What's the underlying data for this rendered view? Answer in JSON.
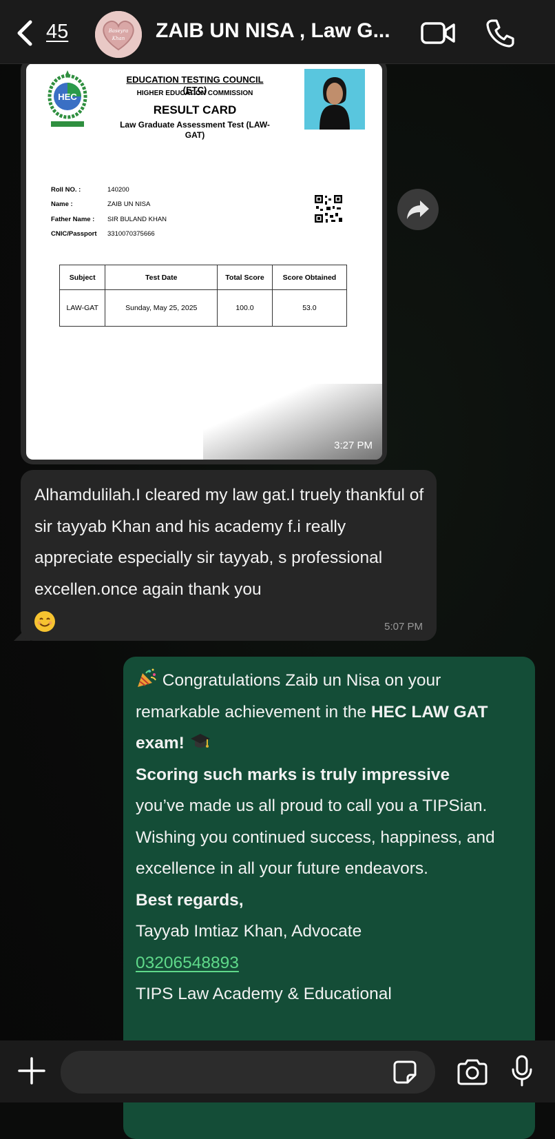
{
  "header": {
    "back_count": "45",
    "title": "ZAIB UN  NISA , Law G...",
    "avatar_text_line1": "Baseyra",
    "avatar_text_line2": "Khan"
  },
  "card": {
    "org": "EDUCATION TESTING COUNCIL (ETC)",
    "commission": "HIGHER EDUCATION COMMISSION",
    "heading": "RESULT CARD",
    "test_name": "Law Graduate Assessment Test (LAW-GAT)",
    "logo_text": "HEC",
    "fields": [
      {
        "key": "Roll NO. :",
        "value": "140200"
      },
      {
        "key": "Name :",
        "value": "ZAIB UN NISA"
      },
      {
        "key": "Father Name :",
        "value": "SIR BULAND KHAN"
      },
      {
        "key": "CNIC/Passport",
        "value": "3310070375666"
      }
    ],
    "table_headers": [
      "Subject",
      "Test Date",
      "Total Score",
      "Score Obtained"
    ],
    "table_row": [
      "LAW-GAT",
      "Sunday, May 25, 2025",
      "100.0",
      "53.0"
    ],
    "time": "3:27 PM"
  },
  "received": {
    "text": "Alhamdulilah.I cleared my law gat.I truely thankful of sir tayyab Khan and his academy f.i really appreciate especially sir tayyab, s professional excellen.once again thank you",
    "time": "5:07 PM"
  },
  "sent": {
    "l1": " Congratulations Zaib un Nisa on your remarkable achievement in the ",
    "l1_bold": "HEC LAW GAT exam!",
    "l2_bold": "Scoring such marks is truly impressive",
    "l3": "you’ve made us all proud to call you a TIPSian.",
    "l4": "Wishing you continued success, happiness, and excellence in all your future endeavors.",
    "l5_bold": "Best regards,",
    "l6": "Tayyab Imtiaz Khan, Advocate",
    "phone": "03206548893",
    "l7": "TIPS Law Academy & Educational"
  },
  "colors": {
    "sent_bubble": "#144d37",
    "received_bubble": "#262626",
    "link": "#5fd98a"
  },
  "icons": [
    "chevron-left-icon",
    "video-icon",
    "phone-icon",
    "forward-icon",
    "plus-icon",
    "sticker-icon",
    "camera-icon",
    "mic-icon"
  ]
}
